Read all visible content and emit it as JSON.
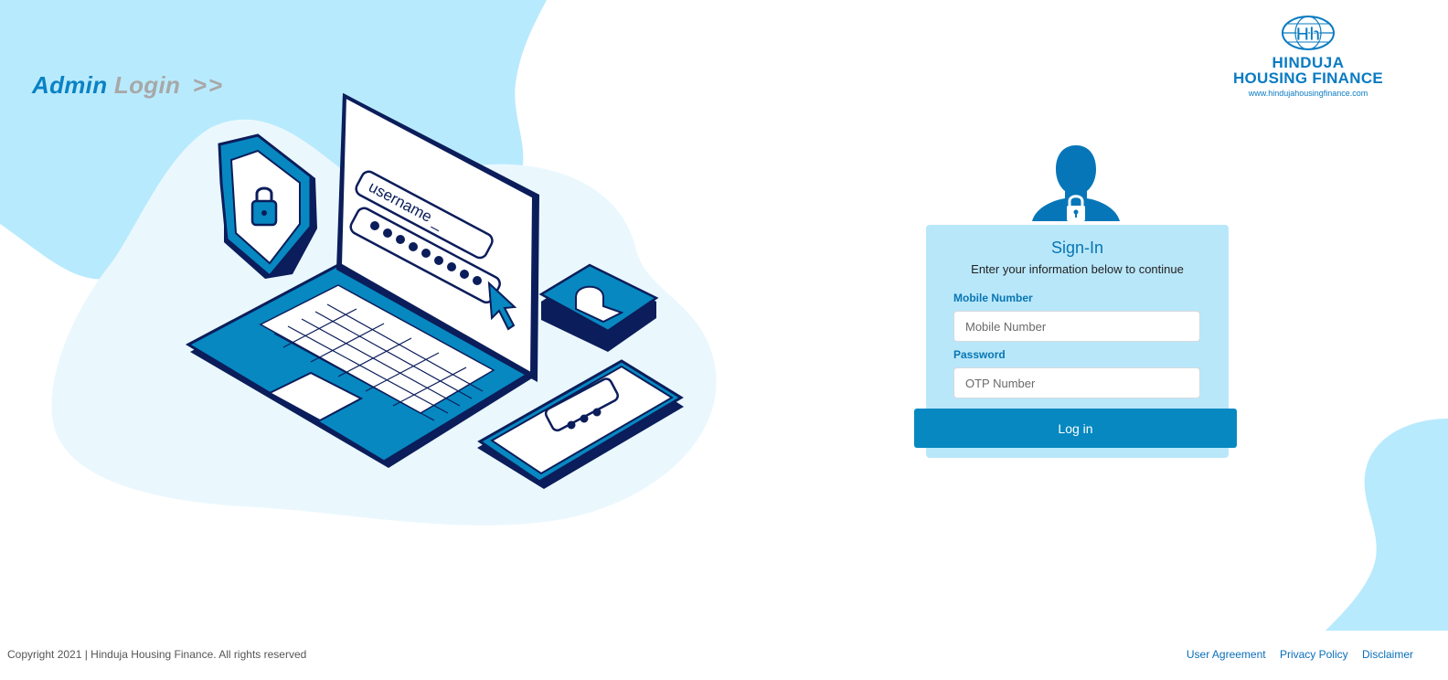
{
  "header": {
    "title_part1": "Admin",
    "title_part2": "Login",
    "title_arrows": ">>"
  },
  "illustration": {
    "username_text": "username _"
  },
  "logo": {
    "mark": "Hh",
    "name_line1": "HINDUJA",
    "name_line2": "HOUSING FINANCE",
    "url": "www.hindujahousingfinance.com"
  },
  "signin": {
    "title": "Sign-In",
    "subtitle": "Enter your information below to continue",
    "mobile_label": "Mobile Number",
    "mobile_placeholder": "Mobile Number",
    "mobile_value": "",
    "password_label": "Password",
    "password_placeholder": "OTP Number",
    "password_value": "",
    "login_button": "Log in"
  },
  "footer": {
    "copyright": "Copyright 2021 | Hinduja Housing Finance. All rights reserved",
    "links": [
      "User Agreement",
      "Privacy Policy",
      "Disclaimer"
    ]
  },
  "colors": {
    "accent": "#0788c1",
    "brand": "#0a7bc2",
    "card_bg": "#b9e7fa",
    "blob": "#b8eafd"
  }
}
